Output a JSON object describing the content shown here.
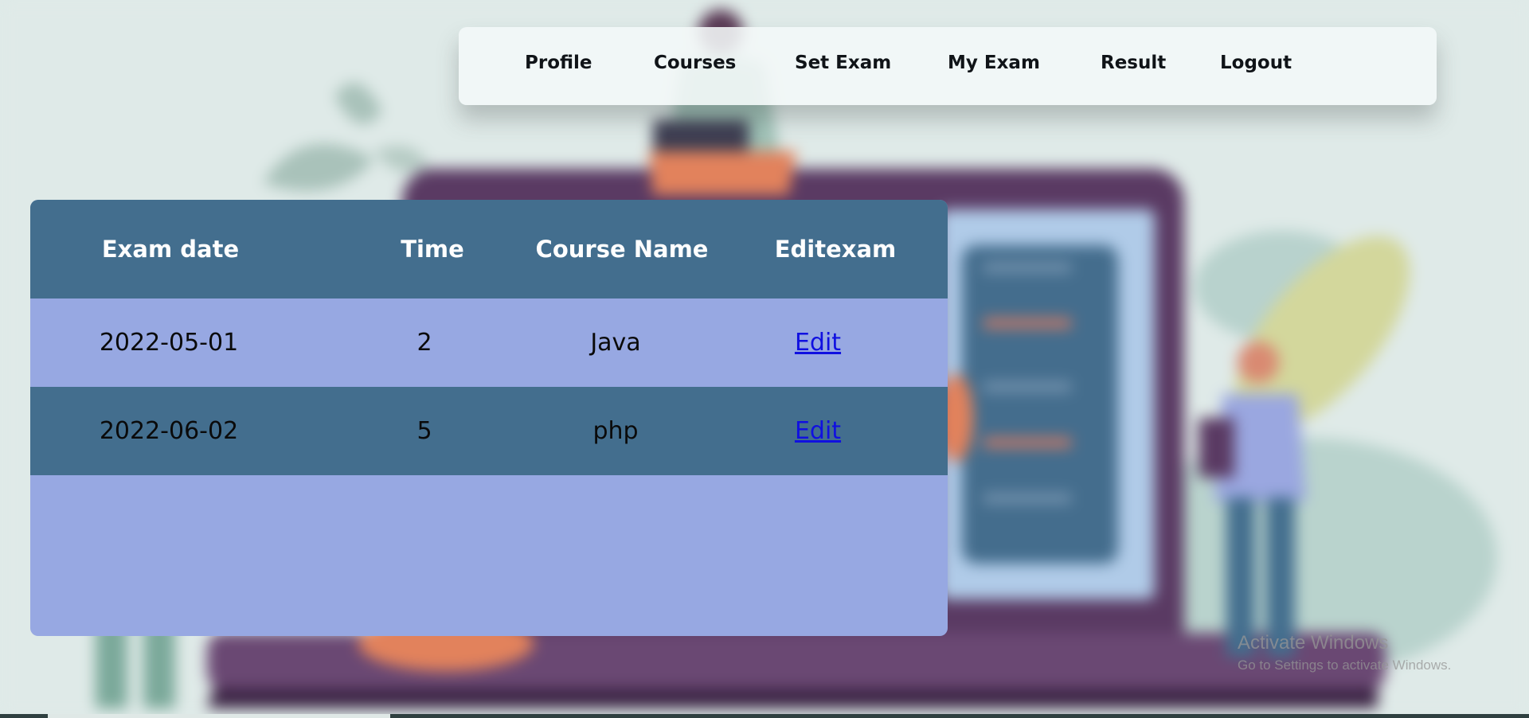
{
  "nav": {
    "items": [
      {
        "label": "Profile"
      },
      {
        "label": "Courses"
      },
      {
        "label": "Set Exam"
      },
      {
        "label": "My Exam"
      },
      {
        "label": "Result"
      },
      {
        "label": "Logout"
      }
    ]
  },
  "table": {
    "headers": [
      "Exam date",
      "Time",
      "Course Name",
      "Editexam"
    ],
    "rows": [
      {
        "exam_date": "2022-05-01",
        "time": "2",
        "course_name": "Java",
        "edit": "Edit"
      },
      {
        "exam_date": "2022-06-02",
        "time": "5",
        "course_name": "php",
        "edit": "Edit"
      }
    ]
  },
  "watermark": {
    "title": "Activate Windows",
    "subtitle": "Go to Settings to activate Windows."
  }
}
